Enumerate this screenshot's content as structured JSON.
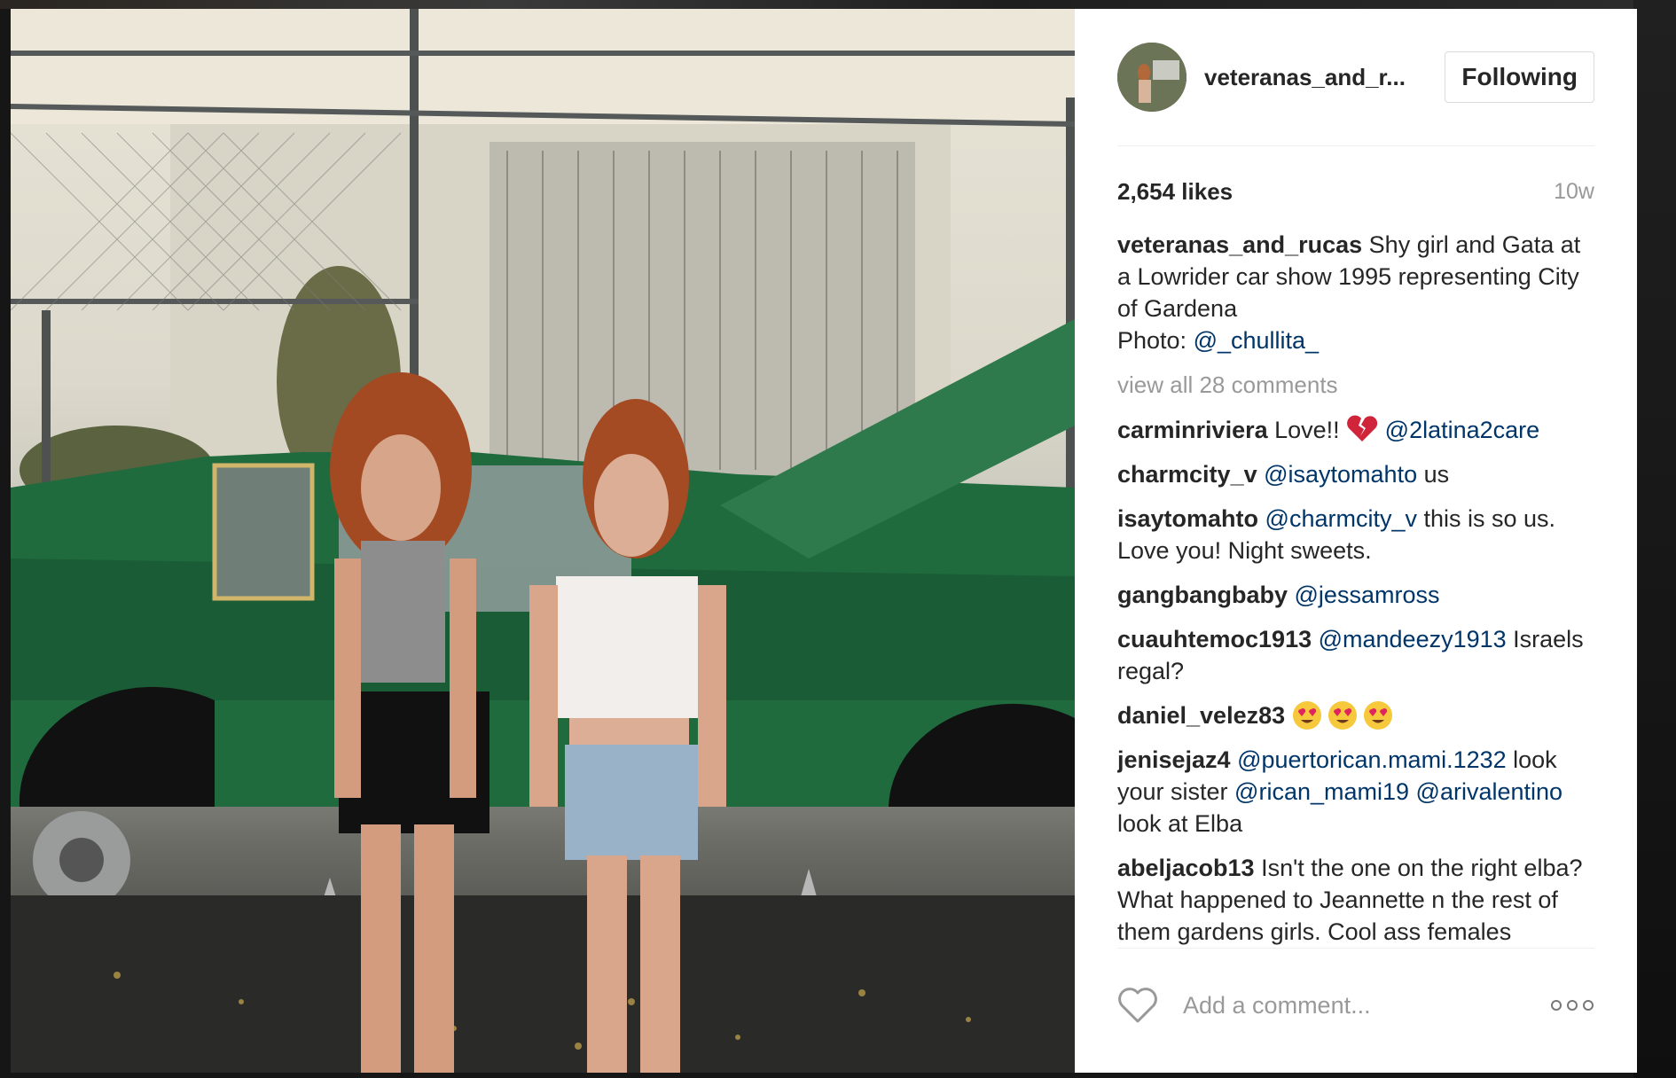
{
  "post": {
    "username_short": "veteranas_and_r...",
    "follow_button": "Following",
    "likes": "2,654 likes",
    "age": "10w",
    "caption": {
      "username": "veteranas_and_rucas",
      "text": " Shy girl and Gata at a Lowrider car show 1995 representing City of Gardena",
      "photo_prefix": "Photo: ",
      "photo_mention": "@_chullita_"
    },
    "view_all_comments": "view all 28 comments",
    "comments": [
      {
        "username": "carminriviera",
        "text": " Love!! ",
        "emoji": "broken-heart",
        "mention": " @2latina2care"
      },
      {
        "username": "charmcity_v",
        "mention": " @isaytomahto",
        "text": " us"
      },
      {
        "username": "isaytomahto",
        "mention": " @charmcity_v",
        "text": " this is so us. Love you! Night sweets."
      },
      {
        "username": "gangbangbaby",
        "mention": " @jessamross"
      },
      {
        "username": "cuauhtemoc1913",
        "mention": " @mandeezy1913",
        "text": " Israels regal?"
      },
      {
        "username": "daniel_velez83",
        "emoji": "heart-eyes x3"
      },
      {
        "username": "jenisejaz4",
        "mention": " @puertorican.mami.1232",
        "text": " look your sister ",
        "mention2": "@rican_mami19",
        "mention3": " @arivalentino",
        "text2": " look at Elba"
      },
      {
        "username": "abeljacob13",
        "text": " Isn't the one on the right elba? What happened to Jeannette n the rest of them gardens girls. Cool ass females"
      }
    ],
    "add_comment_placeholder": "Add a comment..."
  },
  "colors": {
    "text": "#262626",
    "mention": "#003569",
    "muted": "#999999",
    "border": "#dbdbdb"
  },
  "icons": [
    "heart-outline-icon",
    "more-options-icon",
    "broken-heart-emoji",
    "heart-eyes-emoji"
  ]
}
